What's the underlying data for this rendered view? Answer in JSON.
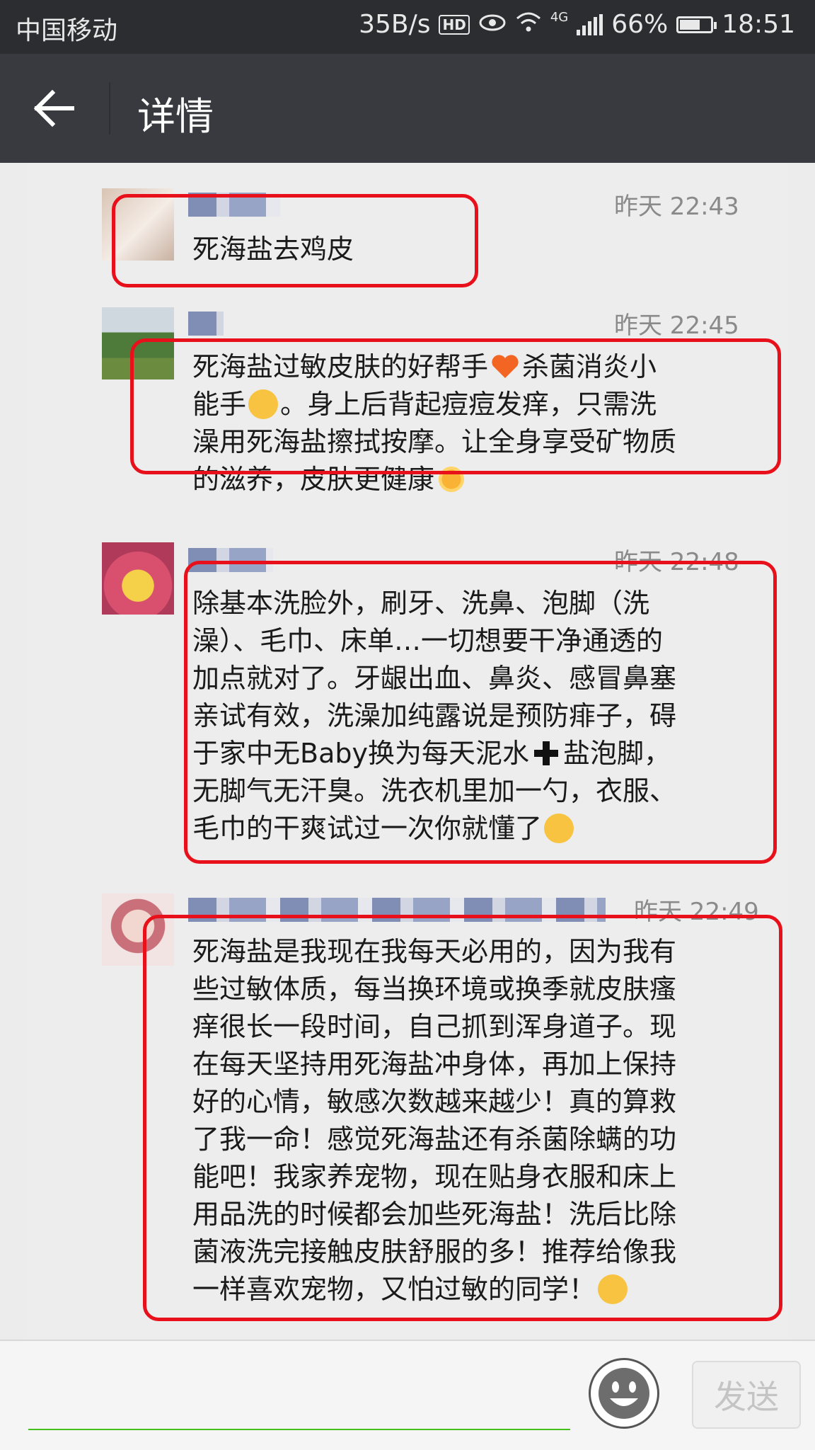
{
  "status_bar": {
    "carrier": "中国移动",
    "net_speed": "35B/s",
    "hd": "HD",
    "network": "4G",
    "battery": "66%",
    "time": "18:51"
  },
  "header": {
    "title": "详情"
  },
  "comments": [
    {
      "time": "昨天 22:43",
      "text": "死海盐去鸡皮"
    },
    {
      "time": "昨天 22:45",
      "lines": [
        "死海盐过敏皮肤的好帮手",
        "杀菌消炎小",
        "能手",
        "。身上后背起痘痘发痒，只需洗",
        "澡用死海盐擦拭按摩。让全身享受矿物质",
        "的滋养，皮肤更健康"
      ]
    },
    {
      "time": "昨天 22:48",
      "lines": [
        "除基本洗脸外，刷牙、洗鼻、泡脚（洗",
        "澡）、毛巾、床单…一切想要干净通透的",
        "加点就对了。牙龈出血、鼻炎、感冒鼻塞",
        "亲试有效，洗澡加纯露说是预防痱子，碍",
        "于家中无Baby换为每天泥水",
        "盐泡脚，",
        "无脚气无汗臭。洗衣机里加一勺，衣服、",
        "毛巾的干爽试过一次你就懂了"
      ]
    },
    {
      "time": "昨天 22:49",
      "lines": [
        "死海盐是我现在我每天必用的，因为我有",
        "些过敏体质，每当换环境或换季就皮肤瘙",
        "痒很长一段时间，自己抓到浑身道子。现",
        "在每天坚持用死海盐冲身体，再加上保持",
        "好的心情，敏感次数越来越少！真的算救",
        "了我一命！感觉死海盐还有杀菌除螨的功",
        "能吧！我家养宠物，现在贴身衣服和床上",
        "用品洗的时候都会加些死海盐！洗后比除",
        "菌液洗完接触皮肤舒服的多！推荐给像我",
        "一样喜欢宠物，又怕过敏的同学！"
      ]
    }
  ],
  "input_bar": {
    "send_label": "发送"
  },
  "colors": {
    "highlight": "#e8111b",
    "title_bar": "#393a3f",
    "input_underline": "#45c01a"
  }
}
